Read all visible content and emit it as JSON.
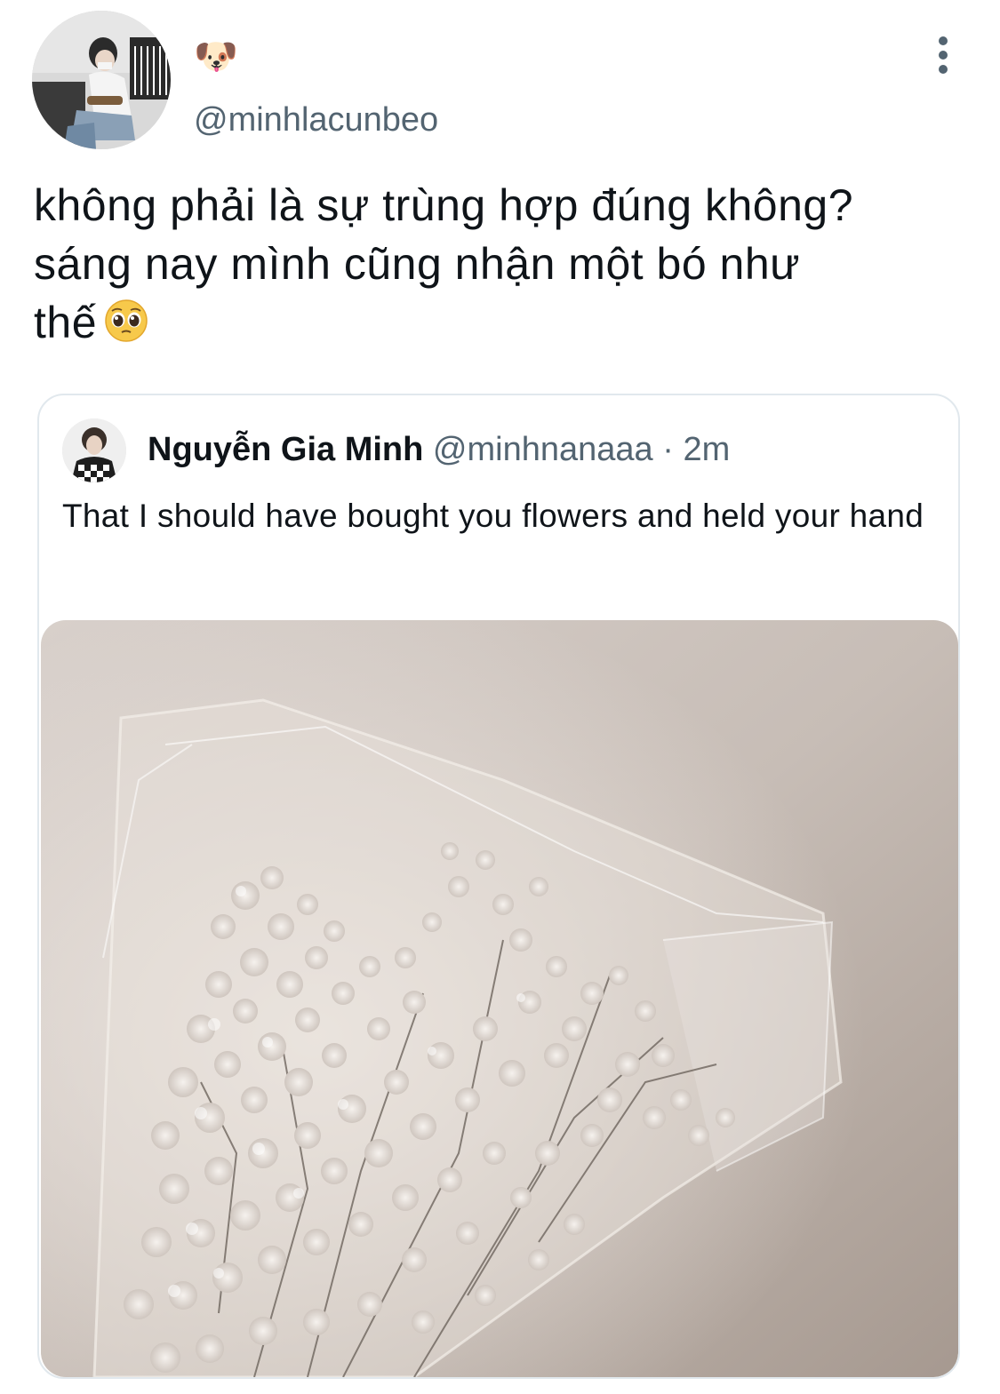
{
  "tweet": {
    "author_display_name": "🐶",
    "author_handle": "@minhlacunbeo",
    "text_lines": [
      "không phải là sự trùng hợp đúng không?",
      "sáng nay mình cũng nhận một bó như",
      "thế"
    ],
    "trailing_emoji_icon": "pleading-face-icon",
    "more_icon": "more-vertical-icon"
  },
  "quote": {
    "author_name": "Nguyễn Gia Minh",
    "author_handle": "@minhnanaaa",
    "separator": "·",
    "time": "2m",
    "text": "That I should have bought you flowers and held your hand",
    "media_icon": "flower-bouquet-photo"
  },
  "colors": {
    "text_primary": "#0f1419",
    "text_secondary": "#536471",
    "card_border": "#e1e8ed",
    "photo_tone": "#bfb5ad"
  }
}
